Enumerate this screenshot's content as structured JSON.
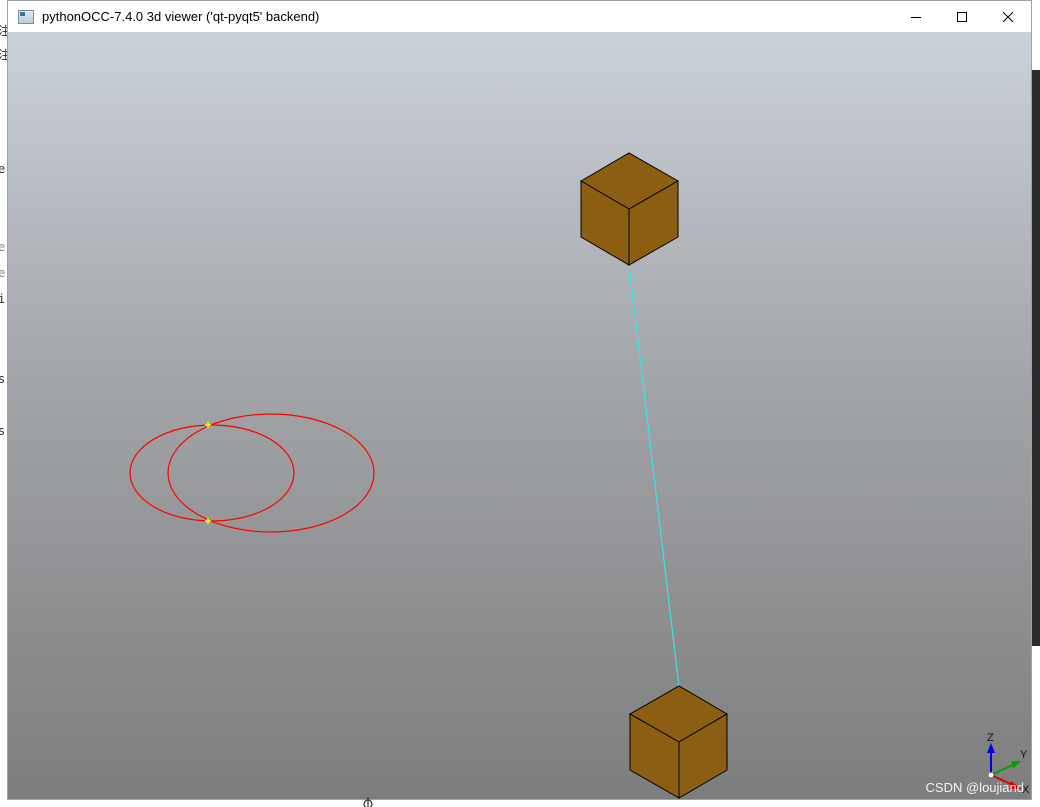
{
  "window": {
    "title": "pythonOCC-7.4.0 3d viewer ('qt-pyqt5' backend)",
    "controls": {
      "minimize": "minimize",
      "maximize": "maximize",
      "close": "close"
    }
  },
  "background_app": {
    "fragments": [
      "注",
      "e",
      "e",
      "e",
      "i",
      "s",
      "s"
    ]
  },
  "viewer": {
    "background_top_color": "#cbd1d9",
    "background_bottom_color": "#7d7d7d",
    "shapes": [
      {
        "type": "box",
        "color": "#8b5e12",
        "name": "upper-box"
      },
      {
        "type": "box",
        "color": "#8b5e12",
        "name": "lower-box"
      },
      {
        "type": "line",
        "color": "#33e6e6",
        "name": "connecting-edge"
      },
      {
        "type": "ellipse",
        "color": "#ff0000",
        "name": "small-ellipse"
      },
      {
        "type": "ellipse",
        "color": "#ff0000",
        "name": "large-ellipse"
      },
      {
        "type": "intersection-point",
        "color": "#ffff00",
        "name": "upper-intersection"
      },
      {
        "type": "intersection-point",
        "color": "#ffff00",
        "name": "lower-intersection"
      }
    ],
    "triedron": {
      "x_label": "X",
      "y_label": "Y",
      "z_label": "Z",
      "x_color": "#e00000",
      "y_color": "#00a000",
      "z_color": "#0000e0"
    },
    "watermark": "CSDN @loujiand"
  }
}
